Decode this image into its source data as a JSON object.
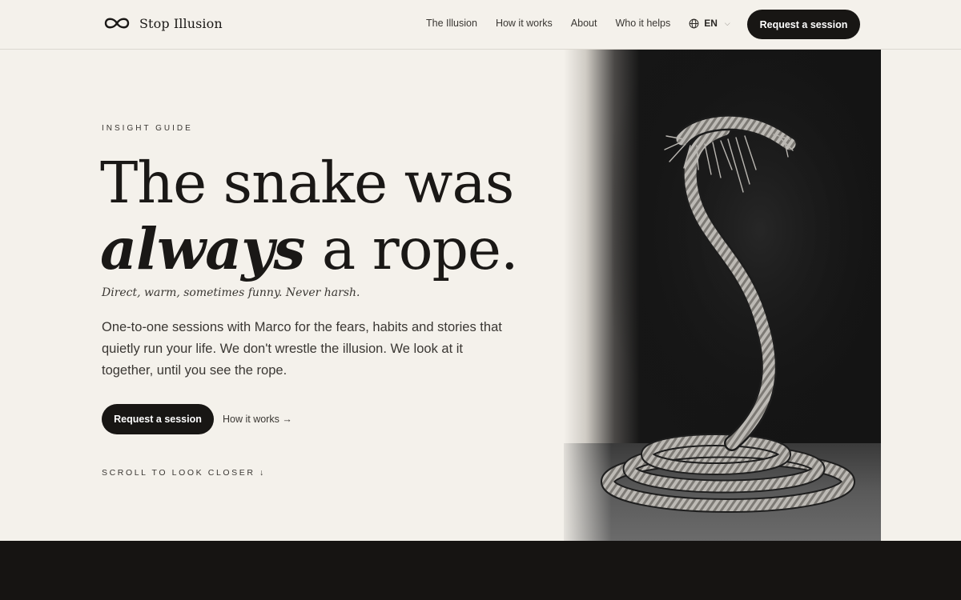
{
  "brand": {
    "name": "Stop Illusion",
    "logo_icon": "infinity-icon"
  },
  "nav": {
    "items": [
      {
        "label": "The Illusion"
      },
      {
        "label": "How it works"
      },
      {
        "label": "About"
      },
      {
        "label": "Who it helps"
      }
    ],
    "language": {
      "label": "EN",
      "icon": "globe-icon",
      "chevron": "⌵"
    },
    "cta_label": "Request a session"
  },
  "hero": {
    "eyebrow": "INSIGHT GUIDE",
    "headline_line1": "The snake was",
    "headline_emphasis": "always",
    "headline_rest": " a rope.",
    "tagline": "Direct, warm, sometimes funny. Never harsh.",
    "body": "One-to-one sessions with Marco for the fears, habits and stories that quietly run your life. We don't wrestle the illusion. We look at it together, until you see the rope.",
    "primary_cta": "Request a session",
    "secondary_link": "How it works →",
    "scroll_hint": "SCROLL TO LOOK CLOSER ↓"
  },
  "image": {
    "subject": "coiled-rope-snake-photo"
  },
  "colors": {
    "background": "#f4f1eb",
    "ink": "#1a1816",
    "button": "#181614"
  }
}
